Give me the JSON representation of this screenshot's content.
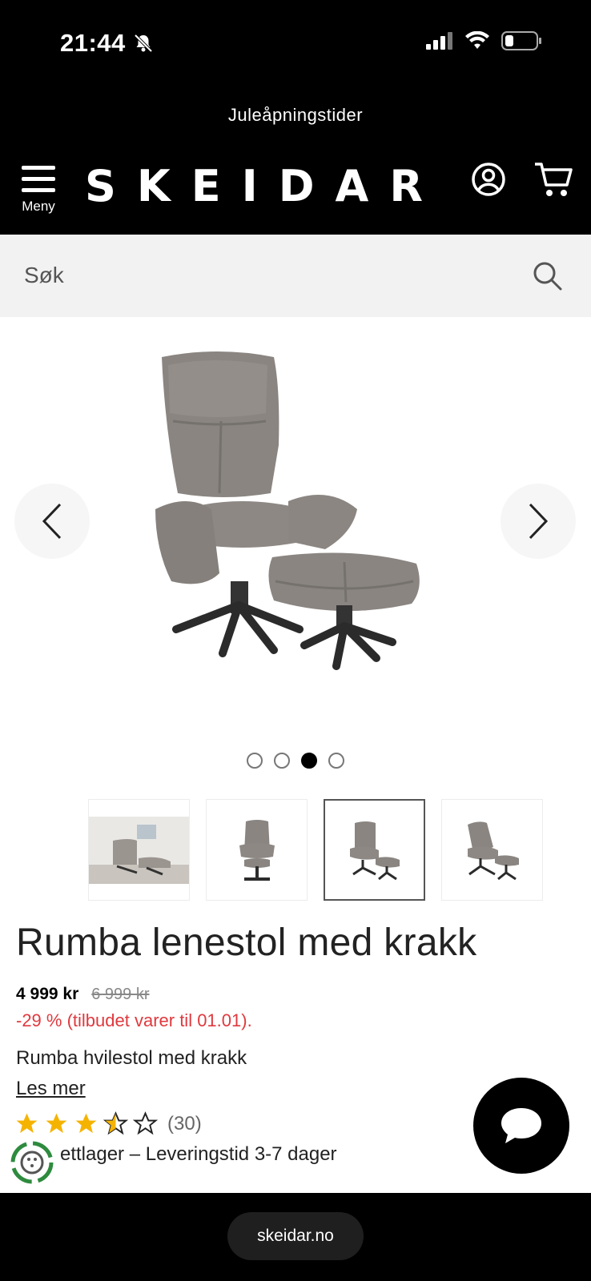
{
  "status": {
    "time": "21:44"
  },
  "announcement": "Juleåpningstider",
  "header": {
    "logo": "SKEIDAR",
    "menu_label": "Meny"
  },
  "search": {
    "placeholder": "Søk"
  },
  "gallery": {
    "dot_count": 4,
    "active_index": 2,
    "thumbnail_count": 4,
    "active_thumbnail": 2
  },
  "product": {
    "title": "Rumba lenestol med krakk",
    "price": "4 999 kr",
    "old_price": "6 999 kr",
    "discount": "-29 % (tilbudet varer til 01.01).",
    "short_description": "Rumba hvilestol med krakk",
    "read_more": "Les mer",
    "rating_value": 3.5,
    "rating_max": 5,
    "rating_count": "(30)",
    "stock_text": "ettlager – Leveringstid 3-7 dager"
  },
  "colors": {
    "accent_red": "#e0393e",
    "star_yellow": "#f5b301",
    "header_bg": "#000000"
  },
  "browser": {
    "url": "skeidar.no"
  }
}
